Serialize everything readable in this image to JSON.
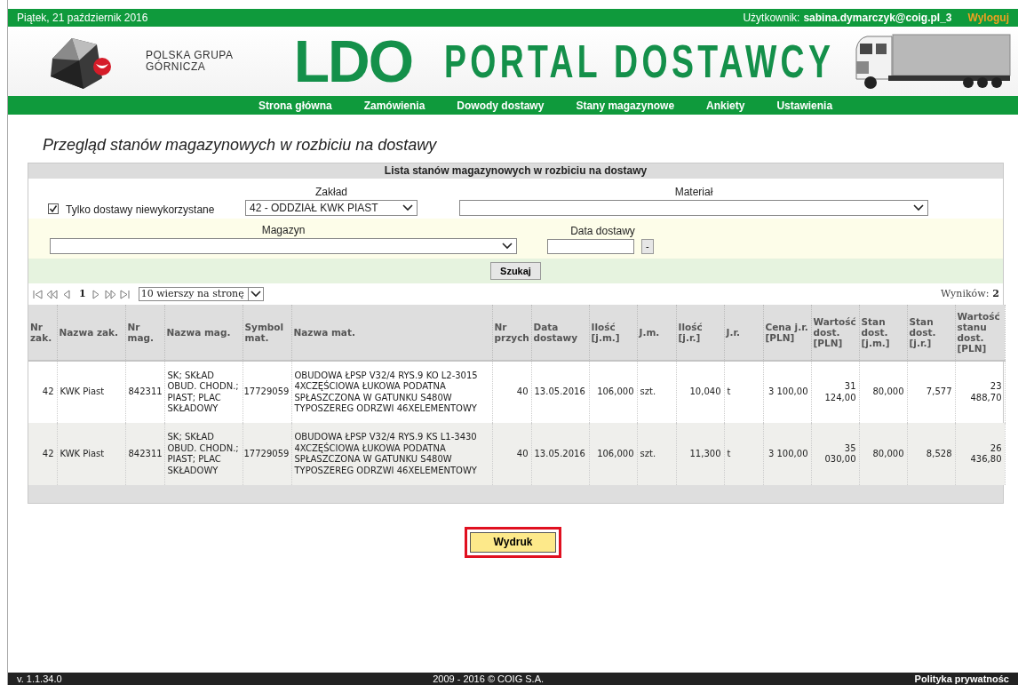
{
  "top_bar": {
    "date": "Piątek, 21 październik 2016",
    "user_label": "Użytkownik:",
    "user": "sabina.dymarczyk@coig.pl_3",
    "logout": "Wyloguj"
  },
  "logo": {
    "lines": [
      "POLSKA GRUPA",
      "GÓRNICZA"
    ]
  },
  "banner": {
    "title": "LDO",
    "subtitle": "PORTAL DOSTAWCY"
  },
  "nav": [
    {
      "label": "Strona główna"
    },
    {
      "label": "Zamówienia"
    },
    {
      "label": "Dowody dostawy"
    },
    {
      "label": "Stany magazynowe"
    },
    {
      "label": "Ankiety"
    },
    {
      "label": "Ustawienia"
    }
  ],
  "page_title": "Przegląd stanów magazynowych w rozbiciu na dostawy",
  "panel": {
    "title": "Lista stanów magazynowych w rozbiciu na dostawy",
    "only_unused": {
      "label": "Tylko dostawy niewykorzystane",
      "checked": true
    },
    "plant": {
      "label": "Zakład",
      "value": "42 - ODDZIAŁ KWK PIAST"
    },
    "material": {
      "label": "Materiał"
    },
    "warehouse": {
      "label": "Magazyn"
    },
    "delivery_date": {
      "label": "Data dostawy",
      "button": "-"
    },
    "search_button": "Szukaj"
  },
  "pager": {
    "page": "1",
    "per_page": "10 wierszy na stronę",
    "results_label": "Wyników:",
    "results_count": "2"
  },
  "table": {
    "columns": [
      "Nr zak.",
      "Nazwa zak.",
      "Nr mag.",
      "Nazwa mag.",
      "Symbol mat.",
      "Nazwa mat.",
      "Nr przych",
      "Data dostawy",
      "Ilość [j.m.]",
      "J.m.",
      "Ilość [j.r.]",
      "J.r.",
      "Cena j.r. [PLN]",
      "Wartość dost. [PLN]",
      "Stan dost. [j.m.]",
      "Stan dost. [j.r.]",
      "Wartość stanu dost. [PLN]"
    ],
    "rows": [
      [
        "42",
        "KWK Piast",
        "842311",
        "SK; SKŁAD OBUD. CHODN.; PIAST; PLAC SKŁADOWY",
        "17729059",
        "OBUDOWA ŁPSP V32/4 RYS.9 KO L2-3015 4XCZĘŚCIOWA ŁUKOWA PODATNA SPŁASZCZONA W GATUNKU S480W TYPOSZEREG ODRZWI 46XELEMENTOWY",
        "40",
        "13.05.2016",
        "106,000",
        "szt.",
        "10,040",
        "t",
        "3 100,00",
        "31 124,00",
        "80,000",
        "7,577",
        "23 488,70"
      ],
      [
        "42",
        "KWK Piast",
        "842311",
        "SK; SKŁAD OBUD. CHODN.; PIAST; PLAC SKŁADOWY",
        "17729059",
        "OBUDOWA ŁPSP V32/4 RYS.9 KS L1-3430 4XCZĘŚCIOWA ŁUKOWA PODATNA SPŁASZCZONA W GATUNKU S480W TYPOSZEREG ODRZWI 46XELEMENTOWY",
        "40",
        "13.05.2016",
        "106,000",
        "szt.",
        "11,300",
        "t",
        "3 100,00",
        "35 030,00",
        "80,000",
        "8,528",
        "26 436,80"
      ]
    ]
  },
  "print_button": "Wydruk",
  "footer": {
    "version": "v. 1.1.34.0",
    "copyright": "2009 - 2016 © COIG S.A.",
    "privacy": "Polityka prywatnośc"
  }
}
